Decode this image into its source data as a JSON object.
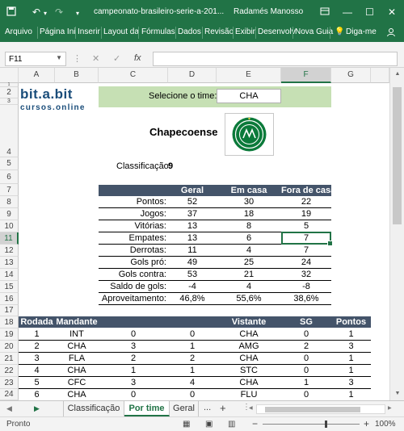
{
  "window": {
    "file_title": "campeonato-brasileiro-serie-a-201...",
    "user_name": "Radamés Manosso"
  },
  "ribbon": {
    "tabs": [
      "Arquivo",
      "Página Ini",
      "Inserir",
      "Layout da",
      "Fórmulas",
      "Dados",
      "Revisão",
      "Exibir",
      "Desenvolv",
      "Nova Guia"
    ],
    "tell_me": "Diga-me",
    "share_icon": "person-icon"
  },
  "formula_bar": {
    "name_box": "F11",
    "formula": ""
  },
  "columns": [
    "A",
    "B",
    "C",
    "D",
    "E",
    "F",
    "G"
  ],
  "rows": [
    "1",
    "2",
    "3",
    "4",
    "5",
    "6",
    "7",
    "8",
    "9",
    "10",
    "11",
    "12",
    "13",
    "14",
    "15",
    "16",
    "17",
    "18",
    "19",
    "20",
    "21",
    "22",
    "23",
    "24"
  ],
  "sheet": {
    "logo_line1": "bit.a.bit",
    "logo_line2": "cursos.online",
    "select_label": "Selecione o time:",
    "select_value": "CHA",
    "team_name": "Chapecoense",
    "class_label": "Classificação:",
    "class_value": "9",
    "stats_headers": [
      "Geral",
      "Em casa",
      "Fora de casa"
    ],
    "stats": [
      {
        "label": "Pontos:",
        "geral": "52",
        "casa": "30",
        "fora": "22"
      },
      {
        "label": "Jogos:",
        "geral": "37",
        "casa": "18",
        "fora": "19"
      },
      {
        "label": "Vitórias:",
        "geral": "13",
        "casa": "8",
        "fora": "5"
      },
      {
        "label": "Empates:",
        "geral": "13",
        "casa": "6",
        "fora": "7"
      },
      {
        "label": "Derrotas:",
        "geral": "11",
        "casa": "4",
        "fora": "7"
      },
      {
        "label": "Gols pró:",
        "geral": "49",
        "casa": "25",
        "fora": "24"
      },
      {
        "label": "Gols contra:",
        "geral": "53",
        "casa": "21",
        "fora": "32"
      },
      {
        "label": "Saldo de gols:",
        "geral": "-4",
        "casa": "4",
        "fora": "-8"
      },
      {
        "label": "Aproveitamento:",
        "geral": "46,8%",
        "casa": "55,6%",
        "fora": "38,6%"
      }
    ],
    "rodada_headers": [
      "Rodada",
      "Mandante",
      "Vistante",
      "SG",
      "Pontos"
    ],
    "rodadas": [
      {
        "rodada": "1",
        "mandante": "INT",
        "g1": "0",
        "g2": "0",
        "visitante": "CHA",
        "sg": "0",
        "pontos": "1"
      },
      {
        "rodada": "2",
        "mandante": "CHA",
        "g1": "3",
        "g2": "1",
        "visitante": "AMG",
        "sg": "2",
        "pontos": "3"
      },
      {
        "rodada": "3",
        "mandante": "FLA",
        "g1": "2",
        "g2": "2",
        "visitante": "CHA",
        "sg": "0",
        "pontos": "1"
      },
      {
        "rodada": "4",
        "mandante": "CHA",
        "g1": "1",
        "g2": "1",
        "visitante": "STC",
        "sg": "0",
        "pontos": "1"
      },
      {
        "rodada": "5",
        "mandante": "CFC",
        "g1": "3",
        "g2": "4",
        "visitante": "CHA",
        "sg": "1",
        "pontos": "3"
      },
      {
        "rodada": "6",
        "mandante": "CHA",
        "g1": "0",
        "g2": "0",
        "visitante": "FLU",
        "sg": "0",
        "pontos": "1"
      }
    ]
  },
  "sheet_tabs": {
    "tabs": [
      "Classificação",
      "Por time",
      "Geral"
    ],
    "active": "Por time",
    "more": "...",
    "add": "+"
  },
  "status_bar": {
    "status": "Pronto",
    "zoom": "100%",
    "zoom_minus": "−",
    "zoom_plus": "+"
  },
  "colors": {
    "excel_green": "#217346",
    "table_header": "#44546a",
    "select_band": "#c6e0b4",
    "logo_blue": "#1a4d7a"
  }
}
